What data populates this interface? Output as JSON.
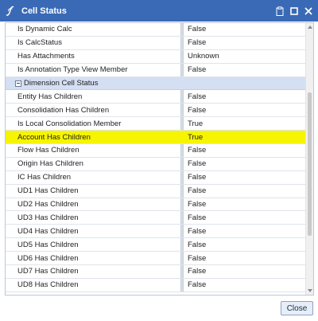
{
  "window": {
    "title": "Cell Status",
    "icons": {
      "logo": "onestream-logo-icon",
      "clipboard": "clipboard-icon",
      "maximize": "maximize-icon",
      "close": "close-icon"
    },
    "colors": {
      "titlebar": "#3a6ab6",
      "group_header": "#d4dff4",
      "highlight": "#f6f400"
    }
  },
  "grid": {
    "rows": [
      {
        "type": "item",
        "label": "Is Dynamic Calc",
        "value": "False"
      },
      {
        "type": "item",
        "label": "Is CalcStatus",
        "value": "False"
      },
      {
        "type": "item",
        "label": "Has Attachments",
        "value": "Unknown"
      },
      {
        "type": "item",
        "label": "Is Annotation Type View Member",
        "value": "False"
      },
      {
        "type": "group",
        "label": "Dimension Cell Status",
        "value": ""
      },
      {
        "type": "item",
        "label": "Entity Has Children",
        "value": "False"
      },
      {
        "type": "item",
        "label": "Consolidation Has Children",
        "value": "False"
      },
      {
        "type": "item",
        "label": "Is Local Consolidation Member",
        "value": "True"
      },
      {
        "type": "item",
        "label": "Account Has Children",
        "value": "True",
        "highlighted": true
      },
      {
        "type": "item",
        "label": "Flow Has Children",
        "value": "False"
      },
      {
        "type": "item",
        "label": "Origin Has Children",
        "value": "False"
      },
      {
        "type": "item",
        "label": "IC Has Children",
        "value": "False"
      },
      {
        "type": "item",
        "label": "UD1 Has Children",
        "value": "False"
      },
      {
        "type": "item",
        "label": "UD2 Has Children",
        "value": "False"
      },
      {
        "type": "item",
        "label": "UD3 Has Children",
        "value": "False"
      },
      {
        "type": "item",
        "label": "UD4 Has Children",
        "value": "False"
      },
      {
        "type": "item",
        "label": "UD5 Has Children",
        "value": "False"
      },
      {
        "type": "item",
        "label": "UD6 Has Children",
        "value": "False"
      },
      {
        "type": "item",
        "label": "UD7 Has Children",
        "value": "False"
      },
      {
        "type": "item",
        "label": "UD8 Has Children",
        "value": "False"
      }
    ],
    "scroll_position": 0.55
  },
  "footer": {
    "close_label": "Close"
  }
}
